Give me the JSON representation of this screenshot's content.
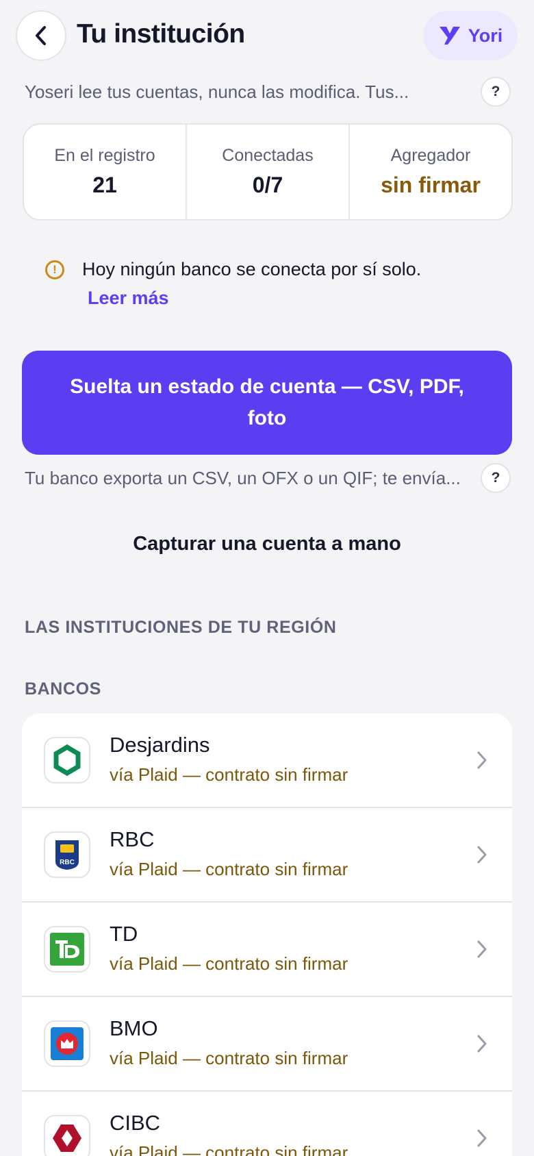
{
  "header": {
    "title": "Tu institución",
    "brand": {
      "name": "Yori",
      "color": "#5b3ff0"
    }
  },
  "intro": {
    "text": "Yoseri lee tus cuentas, nunca las modifica. Tus...",
    "help": "?"
  },
  "stats": [
    {
      "label": "En el registro",
      "value": "21"
    },
    {
      "label": "Conectadas",
      "value": "0/7"
    },
    {
      "label": "Agregador",
      "value": "sin firmar",
      "tone": "warning"
    }
  ],
  "notice": {
    "icon": "warning-circle-icon",
    "text": "Hoy ningún banco se conecta por sí solo.",
    "link": "Leer más"
  },
  "upload": {
    "label": "Suelta un estado de cuenta — CSV, PDF, foto",
    "hint": "Tu banco exporta un CSV, un OFX o un QIF; te envía...",
    "help": "?"
  },
  "manual_capture": "Capturar una cuenta a mano",
  "sections": {
    "region": "LAS INSTITUCIONES DE TU REGIÓN",
    "banks": "BANCOS"
  },
  "banks": [
    {
      "name": "Desjardins",
      "status": "vía Plaid — contrato sin firmar",
      "logo": "desjardins-logo-icon"
    },
    {
      "name": "RBC",
      "status": "vía Plaid — contrato sin firmar",
      "logo": "rbc-logo-icon"
    },
    {
      "name": "TD",
      "status": "vía Plaid — contrato sin firmar",
      "logo": "td-logo-icon"
    },
    {
      "name": "BMO",
      "status": "vía Plaid — contrato sin firmar",
      "logo": "bmo-logo-icon"
    },
    {
      "name": "CIBC",
      "status": "vía Plaid — contrato sin firmar",
      "logo": "cibc-logo-icon"
    }
  ],
  "colors": {
    "accent": "#5c3ef2",
    "warning_text": "#8a5a0c",
    "status_text": "#7c5709",
    "background": "#f4f4f6"
  }
}
